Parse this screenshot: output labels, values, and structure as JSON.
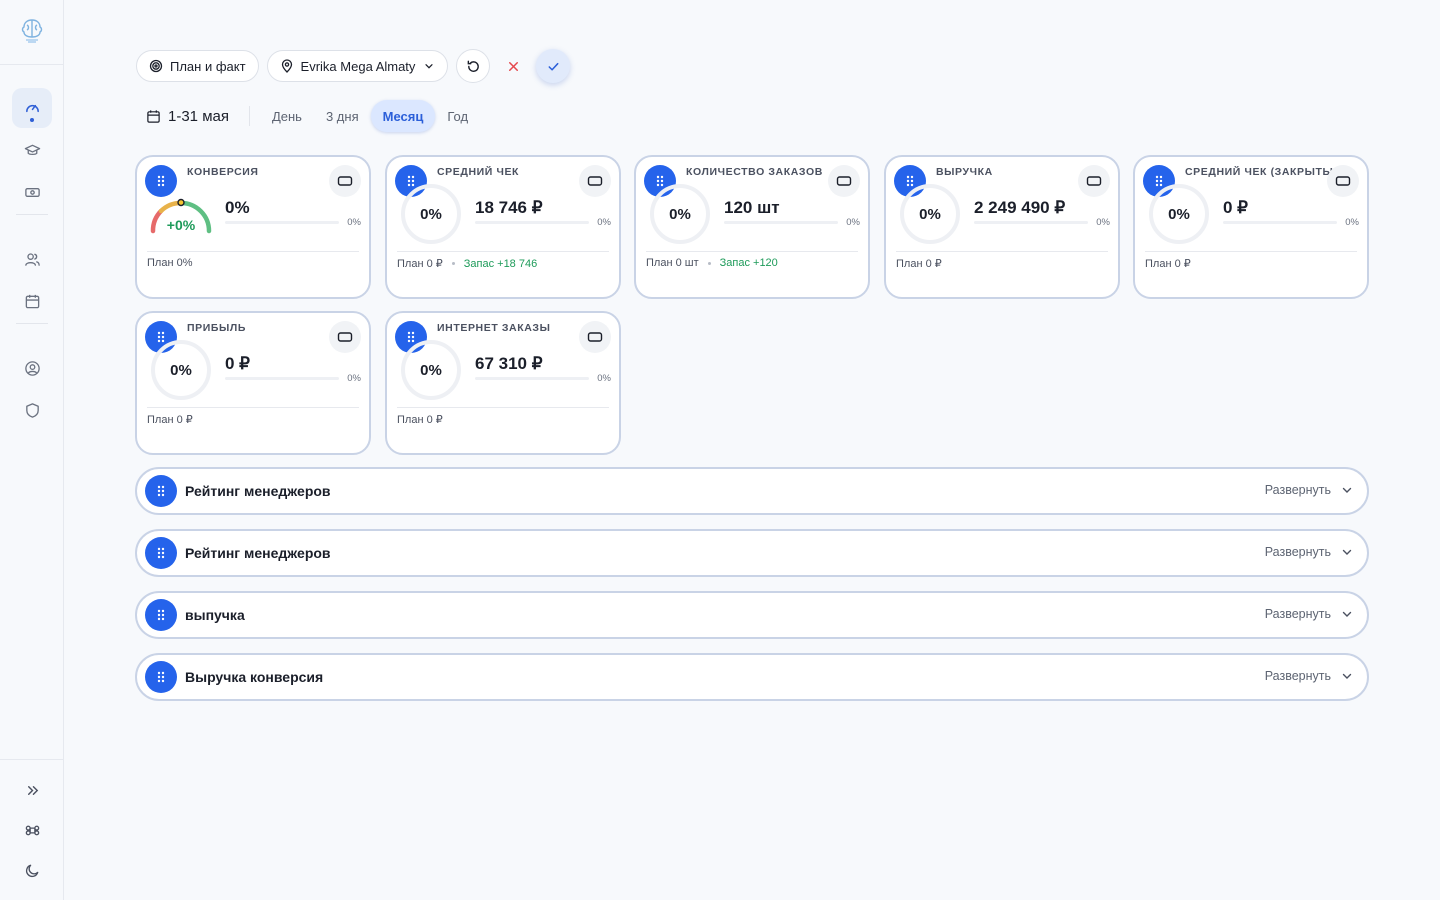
{
  "toolbar": {
    "plan_fact_label": "План и факт",
    "location_label": "Evrika Mega Almaty"
  },
  "period": {
    "date_range": "1-31 мая",
    "tabs": [
      {
        "label": "День",
        "active": false
      },
      {
        "label": "3 дня",
        "active": false
      },
      {
        "label": "Месяц",
        "active": true
      },
      {
        "label": "Год",
        "active": false
      }
    ]
  },
  "cards": [
    {
      "title": "КОНВЕРСИЯ",
      "indicator": "gauge",
      "ring_label": "+0%",
      "value": "0%",
      "progress_pct": "0%",
      "progress": 0,
      "plan": "План 0%",
      "reserve": ""
    },
    {
      "title": "СРЕДНИЙ ЧЕК",
      "indicator": "ring",
      "ring_label": "0%",
      "value": "18 746 ₽",
      "progress_pct": "0%",
      "progress": 0,
      "plan": "План 0 ₽",
      "reserve": "Запас +18 746"
    },
    {
      "title": "КОЛИЧЕСТВО ЗАКАЗОВ",
      "indicator": "ring",
      "ring_label": "0%",
      "value": "120 шт",
      "progress_pct": "0%",
      "progress": 0,
      "plan": "План 0 шт",
      "reserve": "Запас +120"
    },
    {
      "title": "ВЫРУЧКА",
      "indicator": "ring",
      "ring_label": "0%",
      "value": "2 249 490 ₽",
      "progress_pct": "0%",
      "progress": 0,
      "plan": "План 0 ₽",
      "reserve": ""
    },
    {
      "title": "СРЕДНИЙ ЧЕК (ЗАКРЫТЫЕ",
      "indicator": "ring",
      "ring_label": "0%",
      "value": "0 ₽",
      "progress_pct": "0%",
      "progress": 0,
      "plan": "План 0 ₽",
      "reserve": ""
    },
    {
      "title": "ПРИБЫЛЬ",
      "indicator": "ring",
      "ring_label": "0%",
      "value": "0 ₽",
      "progress_pct": "0%",
      "progress": 0,
      "plan": "План 0 ₽",
      "reserve": ""
    },
    {
      "title": "ИНТЕРНЕТ ЗАКАЗЫ",
      "indicator": "ring",
      "ring_label": "0%",
      "value": "67 310 ₽",
      "progress_pct": "0%",
      "progress": 0,
      "plan": "План 0 ₽",
      "reserve": ""
    }
  ],
  "sections": [
    {
      "title": "Рейтинг менеджеров",
      "expand_label": "Развернуть"
    },
    {
      "title": "Рейтинг менеджеров",
      "expand_label": "Развернуть"
    },
    {
      "title": "выпучка",
      "expand_label": "Развернуть"
    },
    {
      "title": "Выручка конверсия",
      "expand_label": "Развернуть"
    }
  ],
  "sidebar": {
    "items": [
      {
        "icon": "dashboard-gauge-icon",
        "active": true
      },
      {
        "icon": "graduation-cap-icon",
        "active": false
      },
      {
        "icon": "banknote-icon",
        "active": false
      },
      {
        "icon": "users-icon",
        "active": false
      },
      {
        "icon": "calendar-icon",
        "active": false
      },
      {
        "icon": "user-circle-icon",
        "active": false
      },
      {
        "icon": "shield-icon",
        "active": false
      }
    ],
    "bottom": [
      "expand-chevrons-icon",
      "command-key-icon",
      "moon-icon"
    ]
  },
  "colors": {
    "accent": "#2563eb",
    "active_tab_bg": "#dbe7ff",
    "card_border": "#c9d3e6",
    "reserve_green": "#1e9b5a",
    "cancel_red": "#e5484d"
  }
}
